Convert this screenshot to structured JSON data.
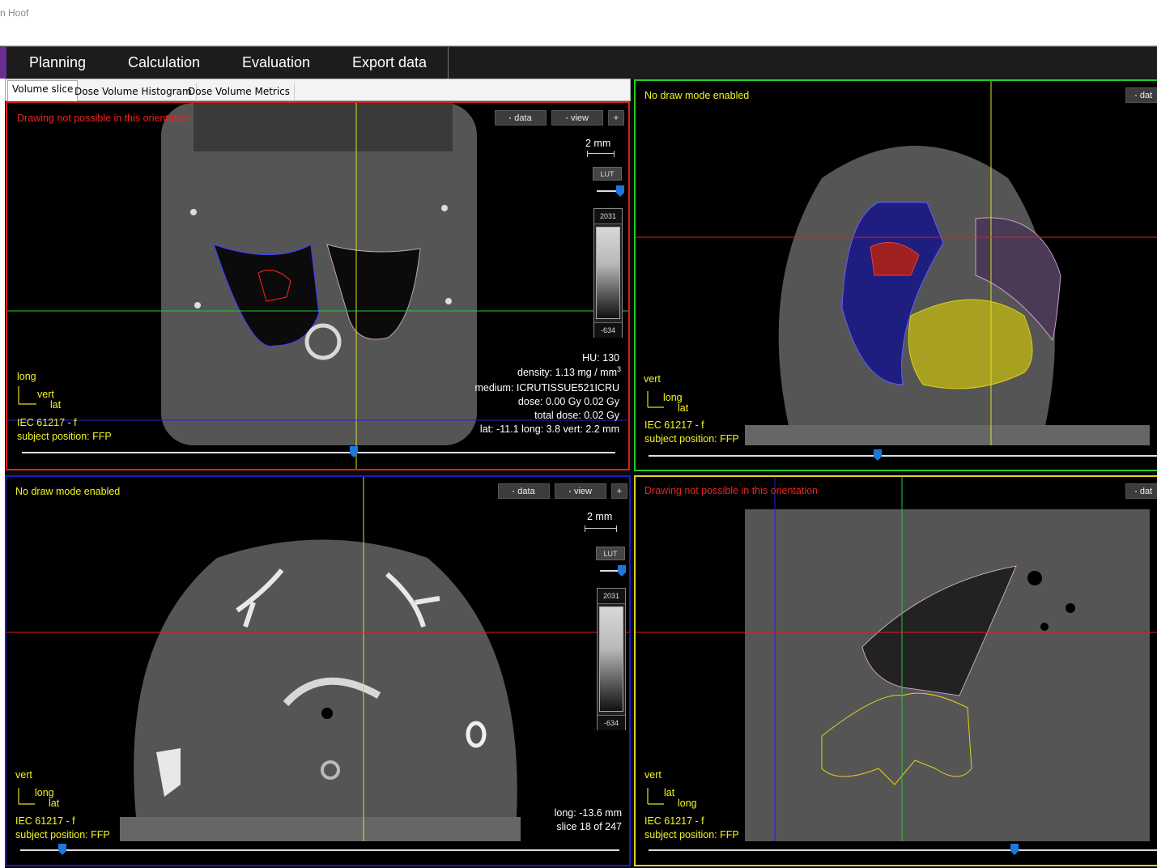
{
  "window": {
    "title_fragment": "n Hoof"
  },
  "menu": {
    "items": [
      "Planning",
      "Calculation",
      "Evaluation",
      "Export data"
    ]
  },
  "tabs": {
    "items": [
      "Volume slice",
      "Dose Volume Histogram",
      "Dose Volume Metrics"
    ],
    "active": "Volume slice"
  },
  "colors": {
    "red_frame": "#e01e1e",
    "green_frame": "#22cc22",
    "blue_frame": "#1a1acc",
    "yellow_frame": "#e0d21e",
    "status_yellow": "#f5f51e",
    "status_red": "#ee2222",
    "slider_thumb": "#1e78d8"
  },
  "views": {
    "coronal": {
      "status": "Drawing not possible in this orientation",
      "btn_data": "data",
      "btn_view": "view",
      "btn_plus": "+",
      "scale": "2 mm",
      "lut_label": "LUT",
      "lut_max": "2031",
      "lut_min": "-634",
      "axis_up": "long",
      "axis_right_top": "vert",
      "axis_right_bottom": "lat",
      "standard": "IEC 61217 - f",
      "position": "subject position: FFP",
      "hu": "HU:   130",
      "density": "density: 1.13  mg / mm",
      "density_sup": "3",
      "medium": "medium: ICRUTISSUE521ICRU",
      "dose": "dose:  0.00 Gy  0.02 Gy",
      "total_dose": "total dose:  0.02 Gy",
      "coords": "lat: -11.1  long: 3.8  vert: 2.2 mm",
      "slider_fraction": 0.56
    },
    "transverse_top": {
      "status": "No draw mode enabled",
      "btn_data": "dat",
      "axis_up": "vert",
      "axis_right_top": "long",
      "axis_right_bottom": "lat",
      "standard": "IEC 61217 - f",
      "position": "subject position: FFP",
      "slider_fraction": 0.45
    },
    "transverse_bottom": {
      "status": "No draw mode enabled",
      "btn_data": "data",
      "btn_view": "view",
      "btn_plus": "+",
      "scale": "2 mm",
      "lut_label": "LUT",
      "lut_max": "2031",
      "lut_min": "-634",
      "axis_up": "vert",
      "axis_right_top": "long",
      "axis_right_bottom": "lat",
      "standard": "IEC 61217 - f",
      "position": "subject position: FFP",
      "long": "long: -13.6 mm",
      "slice": "slice 18 of 247",
      "slider_fraction": 0.07
    },
    "sagittal": {
      "status": "Drawing not possible in this orientation",
      "btn_data": "dat",
      "axis_up": "vert",
      "axis_right_top": "lat",
      "axis_right_bottom": "long",
      "standard": "IEC 61217 - f",
      "position": "subject position: FFP",
      "slider_fraction": 0.72
    }
  }
}
